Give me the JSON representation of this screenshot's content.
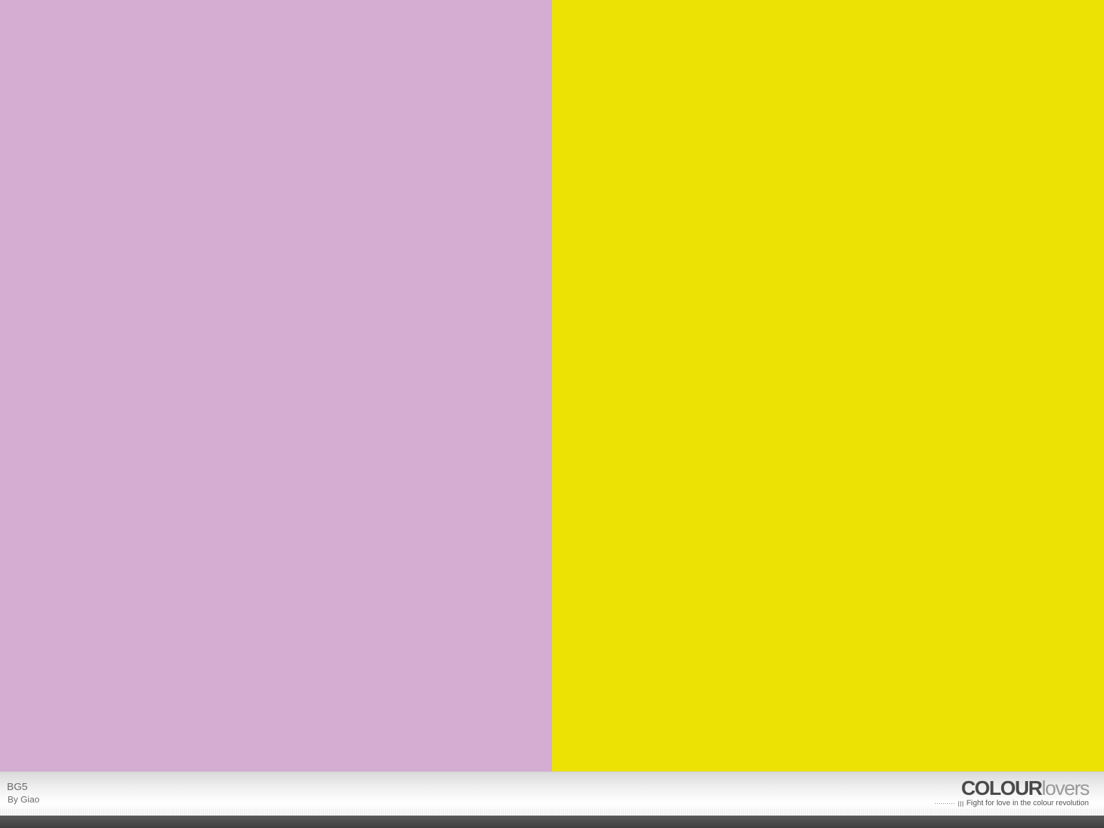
{
  "palette": {
    "title": "BG5",
    "author": "By Giao",
    "colors": [
      "#D5ACD2",
      "#ECE304"
    ]
  },
  "brand": {
    "logo_colour": "COLOUR",
    "logo_lovers": "lovers",
    "tagline": "Fight for love in the colour revolution"
  }
}
